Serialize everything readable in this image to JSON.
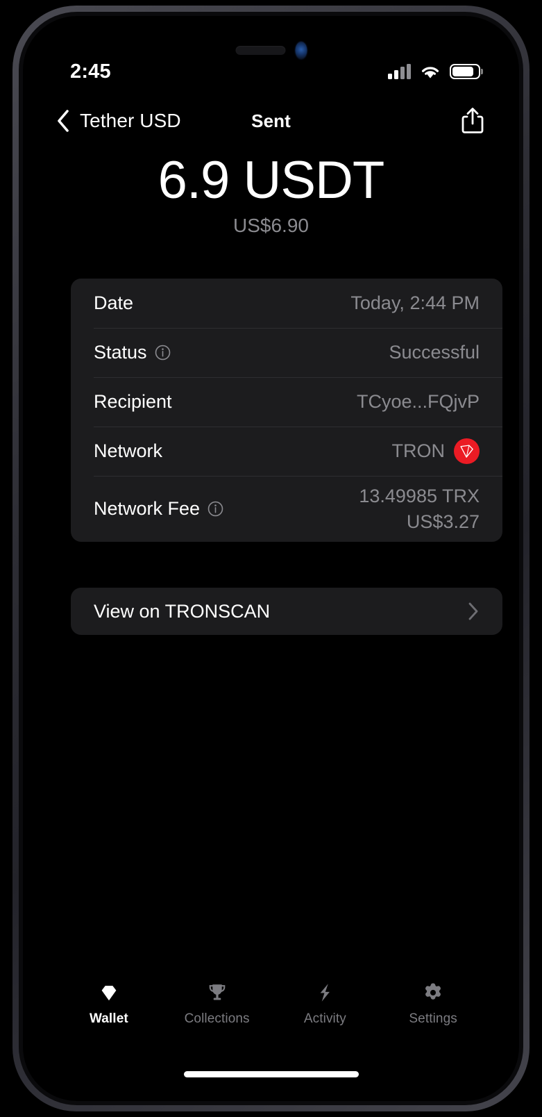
{
  "status_bar": {
    "time": "2:45",
    "signal_icon": "cellular-signal-icon",
    "wifi_icon": "wifi-icon",
    "battery_icon": "battery-icon"
  },
  "nav": {
    "back_icon": "chevron-left-icon",
    "back_label": "Tether USD",
    "title": "Sent",
    "share_icon": "share-icon"
  },
  "amount": {
    "primary": "6.9 USDT",
    "fiat": "US$6.90"
  },
  "details": {
    "rows": [
      {
        "label": "Date",
        "value": "Today, 2:44 PM",
        "has_info": false
      },
      {
        "label": "Status",
        "value": "Successful",
        "has_info": true,
        "info_icon": "info-circle-icon"
      },
      {
        "label": "Recipient",
        "value": "TCyoe...FQjvP",
        "has_info": false
      },
      {
        "label": "Network",
        "value": "TRON",
        "has_info": false,
        "badge_icon": "tron-logo-icon"
      },
      {
        "label": "Network Fee",
        "value": "13.49985 TRX",
        "value_secondary": "US$3.27",
        "has_info": true,
        "info_icon": "info-circle-icon"
      }
    ]
  },
  "explorer_link": {
    "label": "View on TRONSCAN",
    "chevron_icon": "chevron-right-icon"
  },
  "tab_bar": {
    "items": [
      {
        "label": "Wallet",
        "icon": "diamond-icon",
        "active": true
      },
      {
        "label": "Collections",
        "icon": "trophy-icon",
        "active": false
      },
      {
        "label": "Activity",
        "icon": "bolt-icon",
        "active": false
      },
      {
        "label": "Settings",
        "icon": "gear-icon",
        "active": false
      }
    ]
  },
  "colors": {
    "background": "#000000",
    "card": "#1c1c1e",
    "primary_text": "#ffffff",
    "secondary_text": "#8b8b90",
    "tron_red": "#eb1b24",
    "divider": "#2e2e31"
  }
}
